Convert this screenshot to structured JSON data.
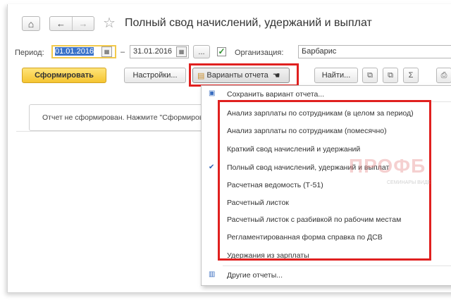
{
  "header": {
    "home_glyph": "⌂",
    "back_glyph": "←",
    "forward_glyph": "→",
    "star_glyph": "☆",
    "title": "Полный свод начислений, удержаний и выплат"
  },
  "filters": {
    "period_label": "Период:",
    "period_from": "01.01.2016",
    "dash": "–",
    "period_to": "31.01.2016",
    "ellipsis_button": "...",
    "org_checked": "✓",
    "org_label": "Организация:",
    "org_value": "Барбарис"
  },
  "toolbar": {
    "generate": "Сформировать",
    "settings": "Настройки...",
    "variants": "Варианты отчета",
    "find": "Найти...",
    "sum_glyph": "Σ"
  },
  "report": {
    "message": "Отчет не сформирован. Нажмите \"Сформировать\" для получения отчета."
  },
  "menu": {
    "save_variant": "Сохранить вариант отчета...",
    "items": [
      "Анализ зарплаты по сотрудникам (в целом за период)",
      "Анализ зарплаты по сотрудникам (помесячно)",
      "Краткий свод начислений и удержаний",
      "Полный свод начислений, удержаний и выплат",
      "Расчетная ведомость (Т-51)",
      "Расчетный листок",
      "Расчетный листок с разбивкой по рабочим местам",
      "Регламентированная форма справка по ДСВ",
      "Удержания из зарплаты"
    ],
    "checked_mark": "✔",
    "other_reports": "Другие отчеты..."
  },
  "watermark": {
    "text": "ПРОФБ",
    "sub": "СЕМИНАРЫ ВИДЕ"
  },
  "colors": {
    "accent_yellow": "#f5c531",
    "highlight_red": "#e0201f",
    "selection_blue": "#3a72c9"
  }
}
